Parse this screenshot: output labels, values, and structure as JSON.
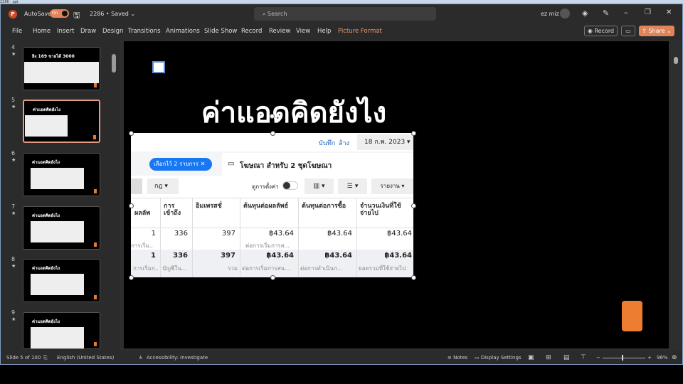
{
  "window": {
    "caption": "2286 - ppt"
  },
  "titlebar": {
    "autosave": "AutoSave",
    "toggle": "On",
    "file": "2286 • Saved ⌄",
    "search_placeholder": "Search",
    "user": "ez miz"
  },
  "ribbon": {
    "tabs": [
      "File",
      "Home",
      "Insert",
      "Draw",
      "Design",
      "Transitions",
      "Animations",
      "Slide Show",
      "Record",
      "Review",
      "View",
      "Help",
      "Picture Format"
    ],
    "record": "Record",
    "share": "Share"
  },
  "slides_panel": {
    "items": [
      {
        "num": "4",
        "title": "ยิง 169 ขายได้ 3000"
      },
      {
        "num": "5",
        "title": "ค่าแอดคิดยังไง",
        "selected": true
      },
      {
        "num": "6",
        "title": "ค่าแอดคิดยังไง"
      },
      {
        "num": "7",
        "title": "ค่าแอดคิดยังไง"
      },
      {
        "num": "8",
        "title": "ค่าแอดคิดยังไง"
      },
      {
        "num": "9",
        "title": "ค่าแอดคิดยังไง"
      }
    ]
  },
  "slide": {
    "title": "ค่าแอดคิดยังไง",
    "picture": {
      "save": "บันทึก",
      "clear": "ล้าง",
      "date": "18 ก.พ. 2023",
      "chip": "เลือกไว้ 2 รายการ",
      "ads_label": "โฆษณา สำหรับ 2 ชุดโฆษณา",
      "rules": "กฎ",
      "view_settings": "ดูการตั้งค่า",
      "report": "รายงาน",
      "headers": [
        "ผลลัพ",
        "การเข้าถึง",
        "อิมเพรสชั่",
        "ต้นทุนต่อผลลัพธ์",
        "ต้นทุนต่อการซื้อ",
        "จำนวนเงินที่ใช้จ่ายไป"
      ],
      "row": {
        "values": [
          "1",
          "336",
          "397",
          "฿43.64",
          "฿43.64",
          "฿43.64"
        ],
        "subs": [
          "การเริ่ม...",
          "",
          "",
          "ต่อการเริ่มการส..."
        ]
      },
      "total": {
        "values": [
          "1",
          "336",
          "397",
          "฿43.64",
          "฿43.64",
          "฿43.64"
        ],
        "subs": [
          "การเริ่มก...",
          "บัญชีใน...",
          "รวม",
          "ต่อการเริ่มการสน...",
          "ต่อการดำเนินก...",
          "ยอดรวมที่ใช้จ่ายไป"
        ]
      }
    }
  },
  "status": {
    "slide": "Slide 5 of 100",
    "language": "English (United States)",
    "accessibility": "Accessibility: Investigate",
    "notes": "Notes",
    "display": "Display Settings",
    "zoom": "96%"
  },
  "colors": {
    "accent": "#e0845a",
    "orange_shape": "#ed7d31",
    "chip": "#1877f2"
  }
}
